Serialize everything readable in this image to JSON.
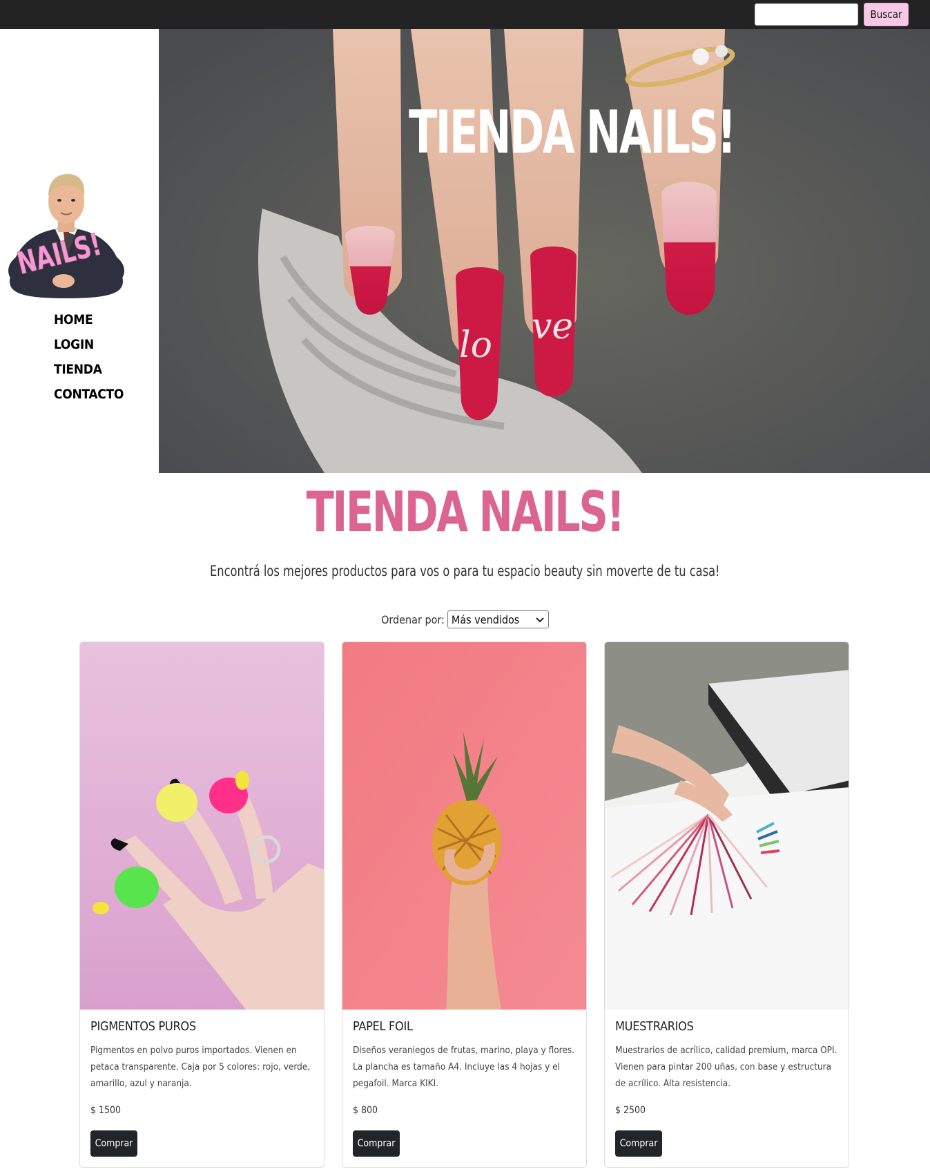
{
  "header": {
    "search_placeholder": "",
    "search_button": "Buscar"
  },
  "sidebar": {
    "logo_text": "NAILS!",
    "nav": [
      {
        "label": "HOME"
      },
      {
        "label": "LOGIN"
      },
      {
        "label": "TIENDA"
      },
      {
        "label": "CONTACTO"
      }
    ]
  },
  "hero": {
    "title": "TIENDA NAILS!",
    "nail_text": "love"
  },
  "main": {
    "title": "TIENDA NAILS!",
    "subtitle": "Encontrá los mejores productos para vos o para tu espacio beauty sin moverte de tu casa!",
    "sort_label": "Ordenar por:",
    "sort_selected": "Más vendidos"
  },
  "products": [
    {
      "title": "PIGMENTOS PUROS",
      "description": "Pigmentos en polvo puros importados. Vienen en petaca transparente. Caja por 5 colores: rojo, verde, amarillo, azul y naranja.",
      "price": "$ 1500",
      "button": "Comprar"
    },
    {
      "title": "PAPEL FOIL",
      "description": "Diseños veraniegos de frutas, marino, playa y flores. La plancha es tamaño A4. Incluye las 4 hojas y el pegafoil. Marca KIKI.",
      "price": "$ 800",
      "button": "Comprar"
    },
    {
      "title": "MUESTRARIOS",
      "description": "Muestrarios de acrílico, calidad premium, marca OPI. Vienen para pintar 200 uñas, con base y estructura de acrílico. Alta resistencia.",
      "price": "$ 2500",
      "button": "Comprar"
    }
  ],
  "colors": {
    "topbar": "#232323",
    "accent_pink": "#db6590",
    "button_pink": "#f8c8e6",
    "button_dark": "#212529"
  }
}
